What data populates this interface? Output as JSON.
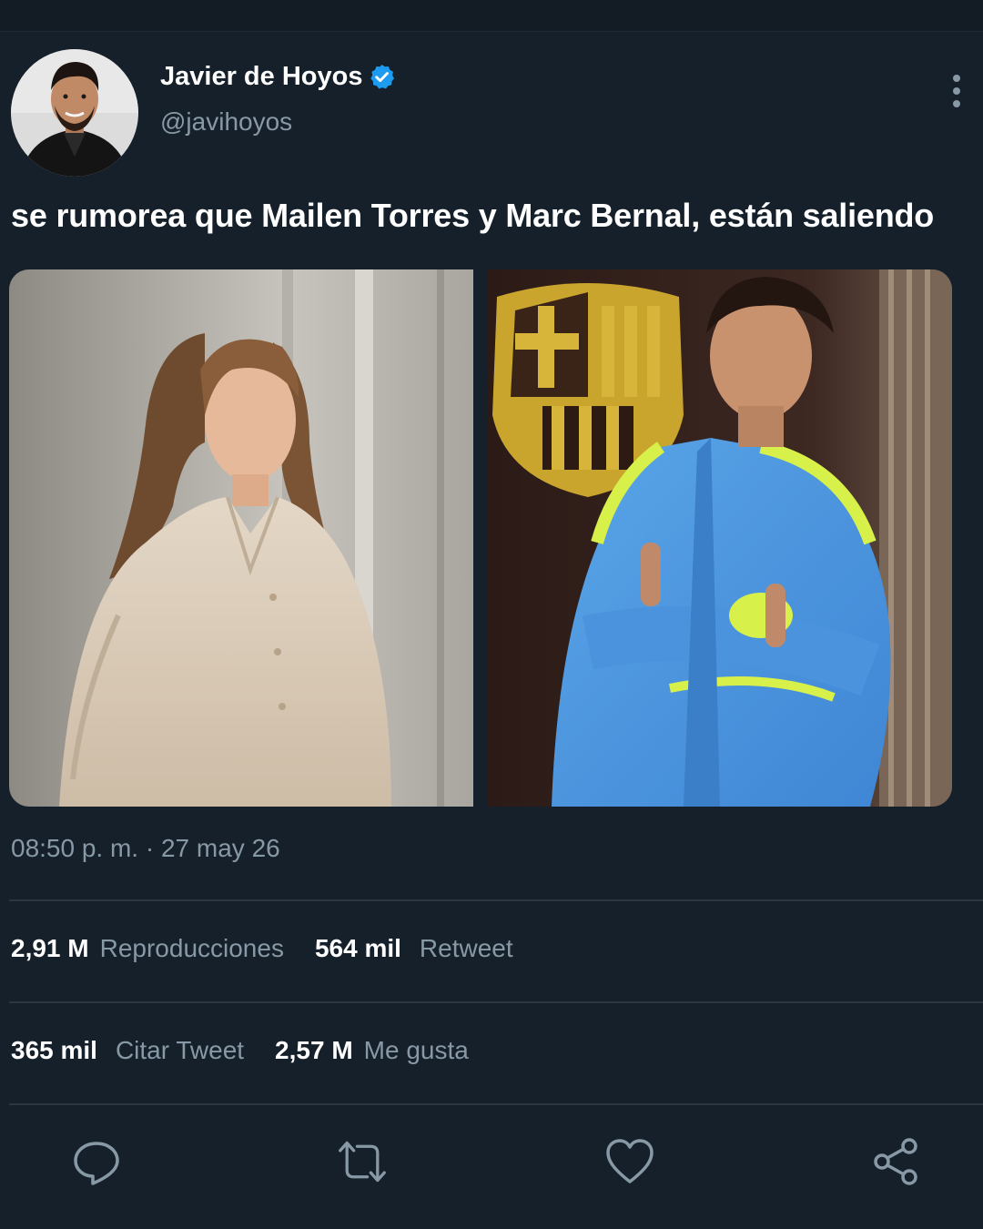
{
  "author": {
    "display_name": "Javier de Hoyos",
    "handle": "@javihoyos",
    "verified": true
  },
  "tweet": {
    "text": "se rumorea que Mailen Torres y Marc Bernal, están saliendo",
    "timestamp": "08:50 p. m. · 27 may 26"
  },
  "stats": {
    "views": {
      "value": "2,91 M",
      "label": "Reproducciones"
    },
    "retweets": {
      "value": "564 mil",
      "label": "Retweet"
    },
    "quotes": {
      "value": "365 mil",
      "label": "Citar Tweet"
    },
    "likes": {
      "value": "2,57 M",
      "label": "Me gusta"
    }
  },
  "actions": [
    "reply-icon",
    "retweet-icon",
    "like-icon",
    "share-icon"
  ],
  "colors": {
    "background": "#15202b",
    "secondary_text": "#8899a6",
    "verified_blue": "#1d9bf0",
    "divider": "#2a3642"
  }
}
